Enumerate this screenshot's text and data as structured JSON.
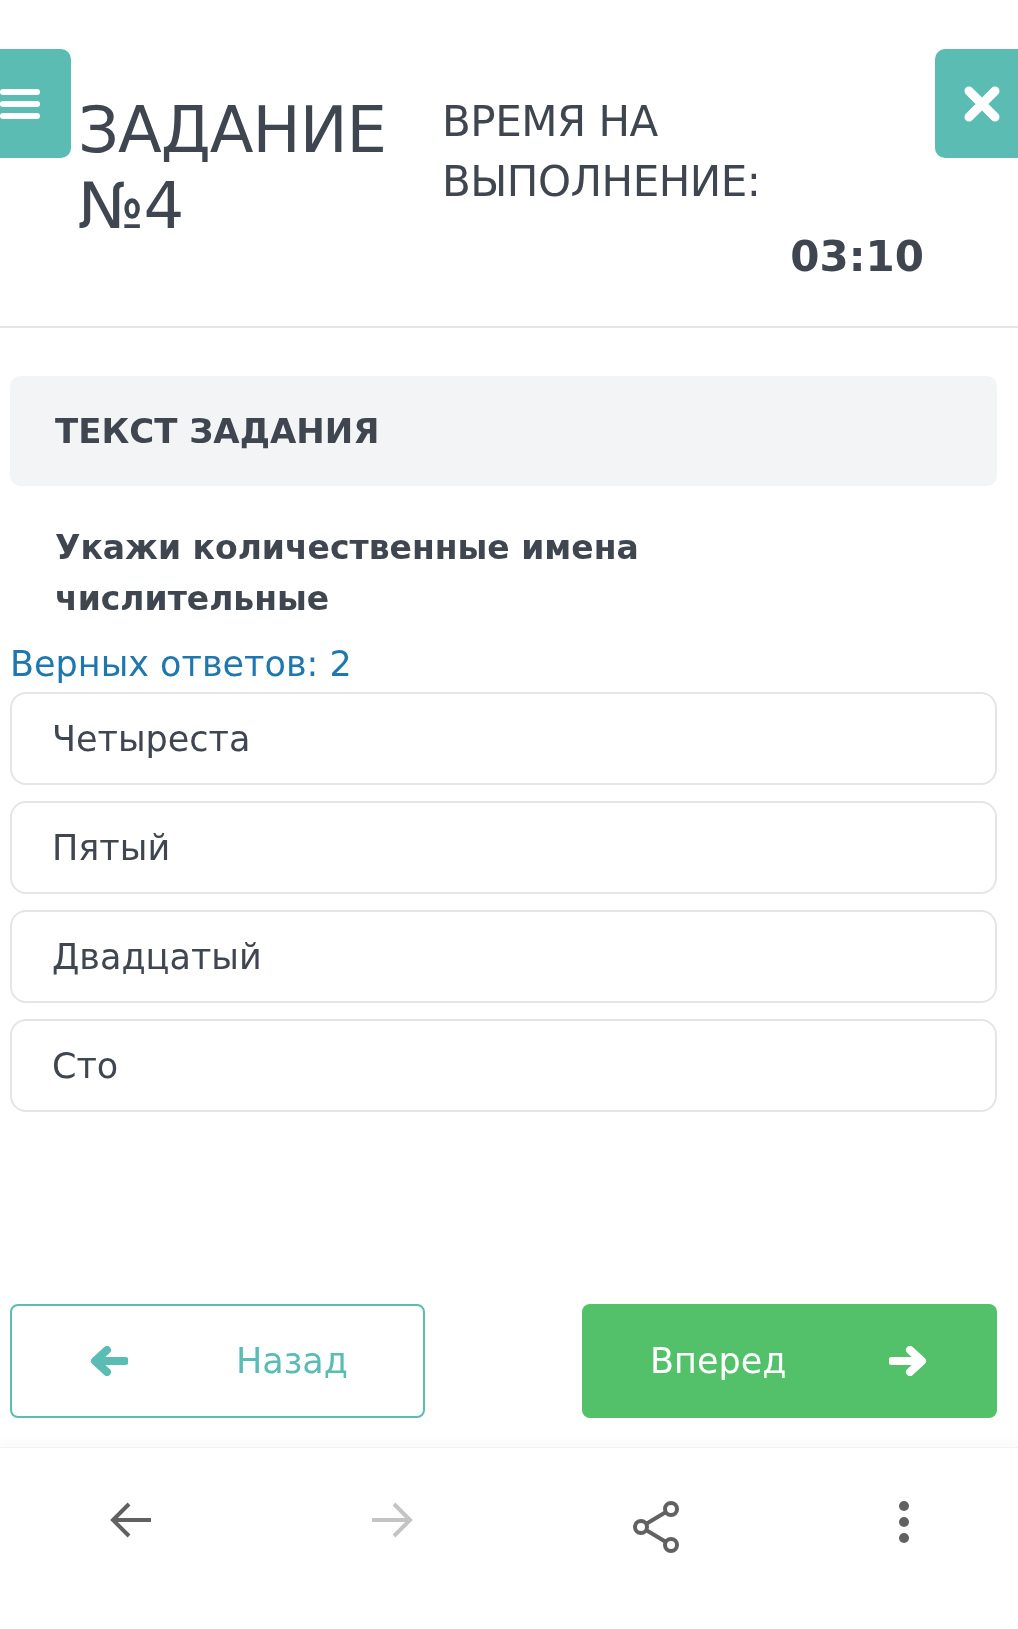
{
  "header": {
    "title": "ЗАДАНИЕ №4",
    "time_label": "ВРЕМЯ НА ВЫПОЛНЕНИЕ:",
    "timer": "03:10"
  },
  "section": {
    "title": "ТЕКСТ ЗАДАНИЯ"
  },
  "question": "Укажи количественные имена числительные",
  "correct_count": "Верных ответов: 2",
  "answers": [
    {
      "label": "Четыреста"
    },
    {
      "label": "Пятый"
    },
    {
      "label": "Двадцатый"
    },
    {
      "label": "Сто"
    }
  ],
  "buttons": {
    "back": "Назад",
    "forward": "Вперед"
  },
  "browser_bar": {
    "back_disabled": false,
    "forward_disabled": true
  }
}
